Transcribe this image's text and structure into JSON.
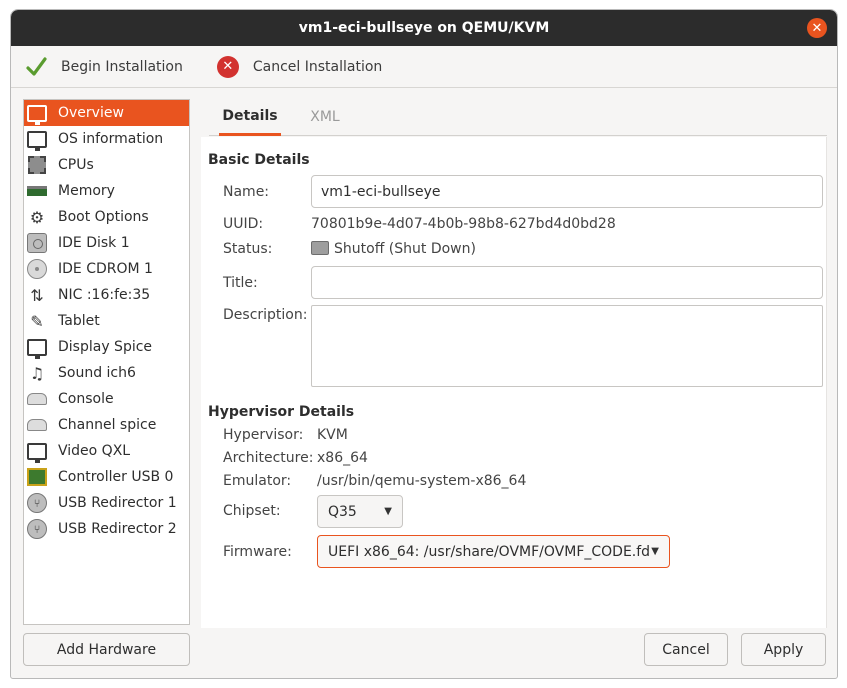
{
  "window": {
    "title": "vm1-eci-bullseye on QEMU/KVM",
    "close_symbol": "✕"
  },
  "toolbar": {
    "begin_label": "Begin Installation",
    "begin_icon": "checkmark-icon",
    "cancel_label": "Cancel Installation",
    "cancel_icon": "cancel-icon",
    "cancel_symbol": "✕"
  },
  "sidebar": {
    "items": [
      {
        "label": "Overview",
        "icon": "monitor-icon",
        "selected": true
      },
      {
        "label": "OS information",
        "icon": "monitor-icon"
      },
      {
        "label": "CPUs",
        "icon": "cpu-icon"
      },
      {
        "label": "Memory",
        "icon": "memory-icon"
      },
      {
        "label": "Boot Options",
        "icon": "gears-icon"
      },
      {
        "label": "IDE Disk 1",
        "icon": "disk-icon"
      },
      {
        "label": "IDE CDROM 1",
        "icon": "cdrom-icon"
      },
      {
        "label": "NIC :16:fe:35",
        "icon": "network-icon"
      },
      {
        "label": "Tablet",
        "icon": "tablet-icon"
      },
      {
        "label": "Display Spice",
        "icon": "monitor-icon"
      },
      {
        "label": "Sound ich6",
        "icon": "sound-icon"
      },
      {
        "label": "Console",
        "icon": "console-icon"
      },
      {
        "label": "Channel spice",
        "icon": "channel-icon"
      },
      {
        "label": "Video QXL",
        "icon": "monitor-icon"
      },
      {
        "label": "Controller USB 0",
        "icon": "controller-icon"
      },
      {
        "label": "USB Redirector 1",
        "icon": "usb-icon"
      },
      {
        "label": "USB Redirector 2",
        "icon": "usb-icon"
      }
    ],
    "add_hardware": "Add Hardware"
  },
  "tabs": {
    "details": "Details",
    "xml": "XML"
  },
  "basic": {
    "title": "Basic Details",
    "name_label": "Name:",
    "name_value": "vm1-eci-bullseye",
    "uuid_label": "UUID:",
    "uuid_value": "70801b9e-4d07-4b0b-98b8-627bd4d0bd28",
    "status_label": "Status:",
    "status_value": "Shutoff (Shut Down)",
    "title_label": "Title:",
    "title_value": "",
    "description_label": "Description:",
    "description_value": ""
  },
  "hypervisor": {
    "title": "Hypervisor Details",
    "hypervisor_label": "Hypervisor:",
    "hypervisor_value": "KVM",
    "arch_label": "Architecture:",
    "arch_value": "x86_64",
    "emulator_label": "Emulator:",
    "emulator_value": "/usr/bin/qemu-system-x86_64",
    "chipset_label": "Chipset:",
    "chipset_value": "Q35",
    "firmware_label": "Firmware:",
    "firmware_value": "UEFI x86_64: /usr/share/OVMF/OVMF_CODE.fd"
  },
  "buttons": {
    "cancel": "Cancel",
    "apply": "Apply"
  },
  "colors": {
    "accent": "#e9541f",
    "titlebar": "#2c2c2c",
    "cancel_red": "#d2322f"
  }
}
